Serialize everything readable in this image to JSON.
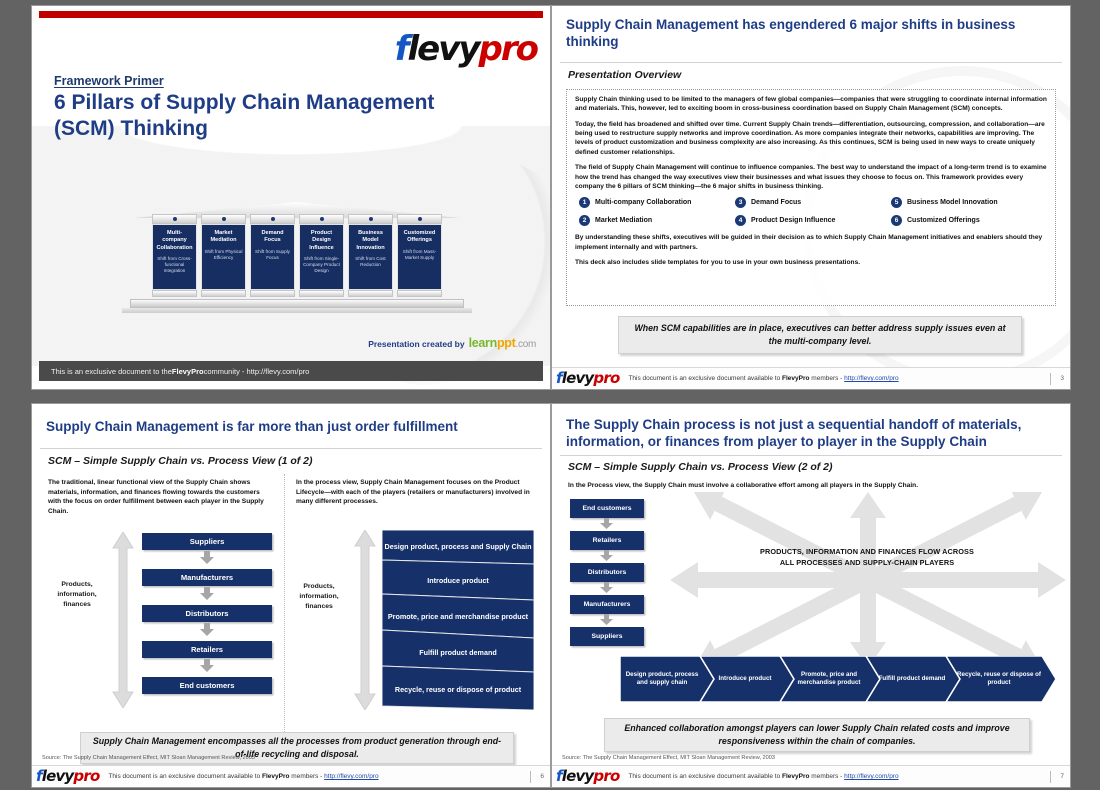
{
  "brand": {
    "flevy_fl": "f",
    "flevy_ev": "levy",
    "flevy_pro": "pro",
    "learnppt_learn": "learn",
    "learnppt_ppt": "ppt",
    "learnppt_dotcom": ".com",
    "accent_navy": "#1f3d86",
    "box_navy": "#16306a",
    "red": "#c00000"
  },
  "slide1": {
    "kicker": "Framework Primer",
    "title": "6 Pillars of Supply Chain Management (SCM) Thinking",
    "created_by": "Presentation created by",
    "bottom_band_pre": "This is an exclusive document to the ",
    "bottom_band_bold": "FlevyPro",
    "bottom_band_post": " community - http://flevy.com/pro",
    "pillars": [
      {
        "title": "Multi-company Collaboration",
        "shift": "Shift from Cross-functional Integration"
      },
      {
        "title": "Market Mediation",
        "shift": "Shift from Physical Efficiency"
      },
      {
        "title": "Demand Focus",
        "shift": "Shift from Supply Focus"
      },
      {
        "title": "Product Design Influence",
        "shift": "Shift from Single-Company Product Design"
      },
      {
        "title": "Business Model Innovation",
        "shift": "Shift from Cost Reduction"
      },
      {
        "title": "Customized Offerings",
        "shift": "Shift from Mass-Market Supply"
      }
    ]
  },
  "slide2": {
    "title": "Supply Chain Management has engendered 6 major shifts in business thinking",
    "subtitle": "Presentation Overview",
    "paragraphs": [
      "Supply Chain thinking used to be limited to the managers of few global companies—companies that were struggling to coordinate internal information and materials.  This, however, led to exciting boom in cross-business coordination based on Supply Chain Management (SCM) concepts.",
      "Today, the field has broadened and shifted over time. Current Supply Chain trends—differentiation, outsourcing, compression, and collaboration—are being used to restructure supply networks and improve coordination.  As more companies integrate their networks, capabilities are improving. The levels of product customization and business complexity are also increasing.  As this continues, SCM is being used in new ways to create uniquely defined customer relationships.",
      "The field of Supply Chain Management will continue to influence companies. The best way to understand the impact of a long-term trend is to examine how the trend has changed the way executives view their businesses and what issues they choose to focus on.   This framework provides every company the 6 pillars of SCM thinking—the 6 major shifts in business thinking."
    ],
    "pillar_items": [
      {
        "num": "1",
        "label": "Multi-company Collaboration"
      },
      {
        "num": "3",
        "label": "Demand Focus"
      },
      {
        "num": "5",
        "label": "Business Model Innovation"
      },
      {
        "num": "2",
        "label": "Market Mediation"
      },
      {
        "num": "4",
        "label": "Product Design Influence"
      },
      {
        "num": "6",
        "label": "Customized Offerings"
      }
    ],
    "paragraphs_after": [
      "By understanding these shifts, executives will be guided in their decision as to which Supply Chain Management initiatives and enablers should they implement internally and with partners.",
      "This deck also includes slide templates for you to use in your own business presentations."
    ],
    "callout": "When SCM capabilities are in place, executives can better address supply issues even at the multi-company level.",
    "page_number": "3"
  },
  "slide3": {
    "title": "Supply Chain Management is far more than just order fulfillment",
    "subtitle": "SCM – Simple Supply Chain vs. Process View (1 of 2)",
    "left_intro": "The traditional, linear functional view of the Supply Chain shows materials, information, and finances flowing towards the customers with the focus on order fulfillment between each player in the Supply Chain.",
    "right_intro": "In the process view, Supply Chain Management focuses on the Product Lifecycle—with each of the players (retailers or manufacturers) involved in many different processes.",
    "side_label": "Products, information, finances",
    "chain": [
      "Suppliers",
      "Manufacturers",
      "Distributors",
      "Retailers",
      "End customers"
    ],
    "lifecycle": [
      "Design product, process and Supply Chain",
      "Introduce product",
      "Promote, price and merchandise product",
      "Fulfill product demand",
      "Recycle, reuse or dispose of product"
    ],
    "callout": "Supply Chain Management encompasses all the processes from product generation through end-of-life recycling and disposal.",
    "source": "Source: The Supply Chain Management Effect, MIT Sloan Management Review, 2003",
    "page_number": "6"
  },
  "slide4": {
    "title": "The Supply Chain process is not just a sequential handoff of materials, information, or finances from player to player in the Supply Chain",
    "subtitle": "SCM – Simple Supply Chain vs. Process View (2 of 2)",
    "intro": "In the Process view, the Supply Chain must involve a collaborative effort among all players in the Supply Chain.",
    "players": [
      "End customers",
      "Retailers",
      "Distributors",
      "Manufacturers",
      "Suppliers"
    ],
    "center_text": "PRODUCTS, INFORMATION AND FINANCES FLOW ACROSS ALL PROCESSES AND SUPPLY-CHAIN PLAYERS",
    "chevrons": [
      "Design product, process and supply chain",
      "Introduce product",
      "Promote, price and merchandise product",
      "Fulfill product demand",
      "Recycle, reuse or dispose of product"
    ],
    "callout": "Enhanced collaboration amongst players can lower Supply Chain related costs and improve responsiveness within the chain of companies.",
    "source": "Source: The Supply Chain Management Effect, MIT Sloan Management Review, 2003",
    "page_number": "7"
  },
  "footer": {
    "pre": "This document is an exclusive document available to ",
    "bold": "FlevyPro",
    "mid": " members - ",
    "link": "http://flevy.com/pro"
  }
}
